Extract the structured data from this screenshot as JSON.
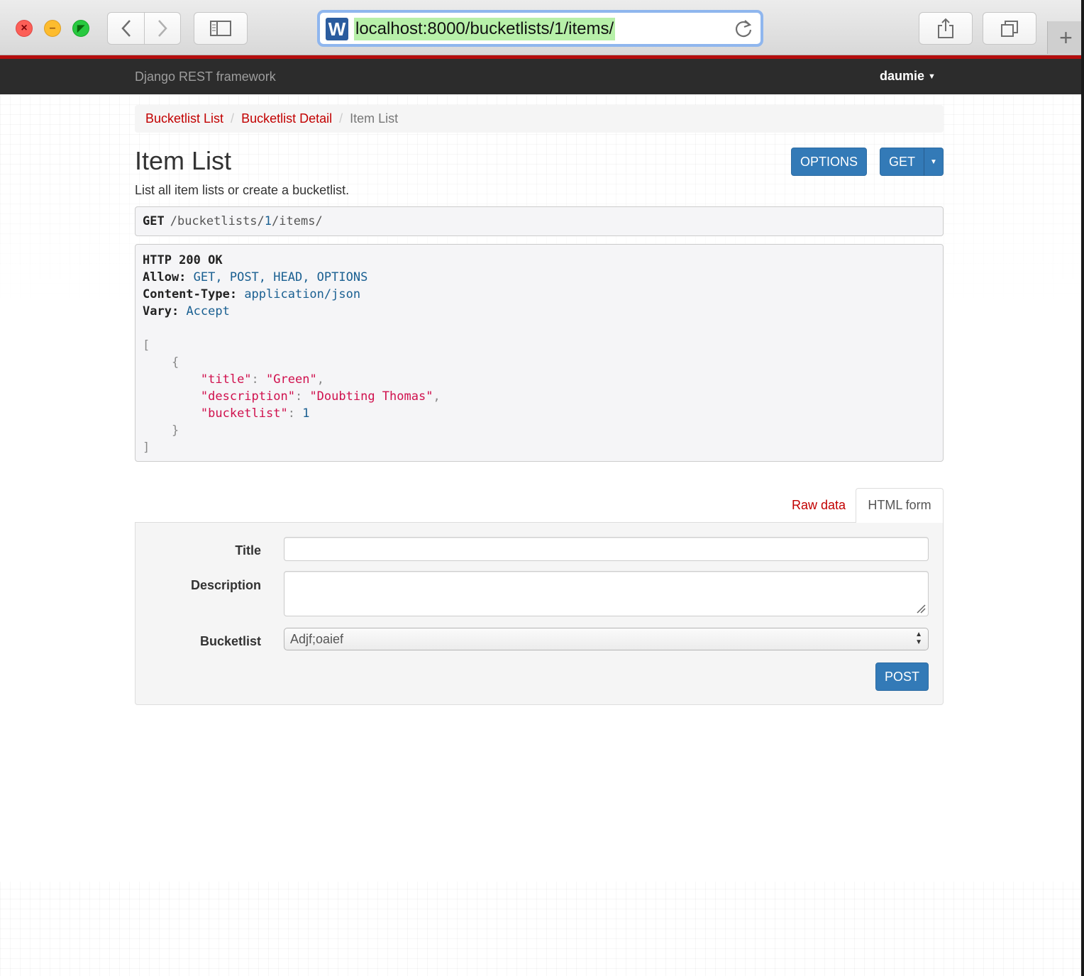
{
  "browser": {
    "url": "localhost:8000/bucketlists/1/items/",
    "site_icon_letter": "W",
    "new_tab_label": "+"
  },
  "navbar": {
    "brand": "Django REST framework",
    "user": "daumie"
  },
  "breadcrumb": {
    "items": [
      "Bucketlist List",
      "Bucketlist Detail",
      "Item List"
    ],
    "separator": "/"
  },
  "header": {
    "title": "Item List",
    "description": "List all item lists or create a bucketlist.",
    "options_label": "OPTIONS",
    "get_label": "GET"
  },
  "request": {
    "method": "GET",
    "path_before": "/bucketlists/",
    "path_id": "1",
    "path_after": "/items/"
  },
  "response": {
    "status": "HTTP 200 OK",
    "headers": [
      {
        "name": "Allow:",
        "value": "GET, POST, HEAD, OPTIONS"
      },
      {
        "name": "Content-Type:",
        "value": "application/json"
      },
      {
        "name": "Vary:",
        "value": "Accept"
      }
    ],
    "body": [
      {
        "title": "Green",
        "description": "Doubting Thomas",
        "bucketlist": 1
      }
    ],
    "keys": {
      "title": "\"title\"",
      "description": "\"description\"",
      "bucketlist": "\"bucketlist\""
    },
    "values": {
      "title": "\"Green\"",
      "description": "\"Doubting Thomas\"",
      "bucketlist": "1"
    }
  },
  "tabs": {
    "raw": "Raw data",
    "html": "HTML form"
  },
  "form": {
    "title_label": "Title",
    "title_value": "",
    "description_label": "Description",
    "description_value": "",
    "bucketlist_label": "Bucketlist",
    "bucketlist_selected": "Adjf;oaief",
    "submit_label": "POST"
  },
  "colors": {
    "accent_red": "#c20000",
    "button_blue": "#337ab7",
    "navbar": "#2c2c2c",
    "json_string": "#d0104d",
    "json_number": "#195f91"
  }
}
